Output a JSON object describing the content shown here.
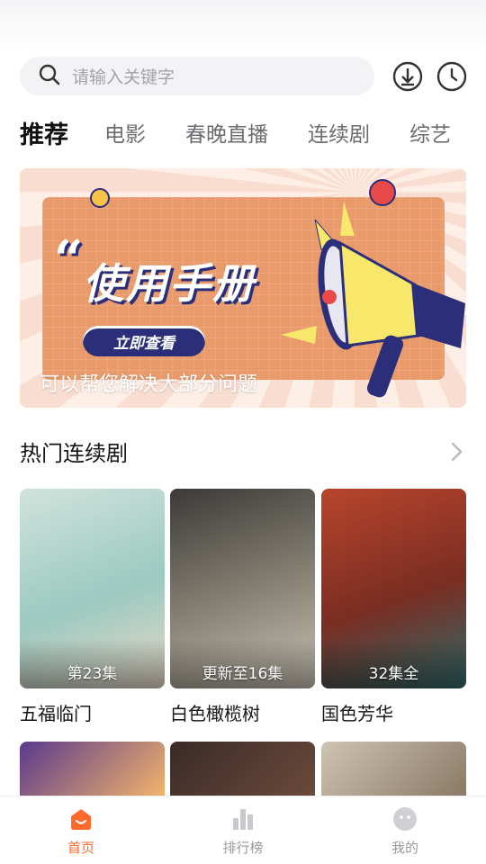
{
  "search": {
    "placeholder": "请输入关键字"
  },
  "header_icons": [
    "download-icon",
    "history-clock-icon"
  ],
  "tabs": [
    {
      "label": "推荐",
      "active": true
    },
    {
      "label": "电影",
      "active": false
    },
    {
      "label": "春晚直播",
      "active": false
    },
    {
      "label": "连续剧",
      "active": false
    },
    {
      "label": "综艺",
      "active": false
    }
  ],
  "banner": {
    "title": "使用手册",
    "quote_mark": "“",
    "button_label": "立即查看",
    "subtitle": "可以帮您解决大部分问题"
  },
  "section": {
    "title": "热门连续剧",
    "arrow_icon": "chevron-right-icon"
  },
  "cards": [
    {
      "title": "五福临门",
      "badge": "第23集",
      "colors": [
        "#cfe3dc",
        "#9cc9c0",
        "#e7d9c9"
      ]
    },
    {
      "title": "白色橄榄树",
      "badge": "更新至16集",
      "colors": [
        "#3b3a38",
        "#8a8476",
        "#c9c3b6"
      ]
    },
    {
      "title": "国色芳华",
      "badge": "32集全",
      "colors": [
        "#b8452c",
        "#7a2d22",
        "#2f6b6a"
      ]
    }
  ],
  "row2_colors": [
    [
      "#5a3a8c",
      "#f2b36b"
    ],
    [
      "#3a2a28",
      "#6b4a3a"
    ],
    [
      "#cfc3b3",
      "#8a7a66"
    ]
  ],
  "bottom_nav": [
    {
      "label": "首页",
      "icon": "home-smile-icon",
      "active": true
    },
    {
      "label": "排行榜",
      "icon": "ranking-bars-icon",
      "active": false
    },
    {
      "label": "我的",
      "icon": "profile-face-icon",
      "active": false
    }
  ],
  "colors": {
    "accent": "#ff6a2c",
    "banner_navy": "#2b2f7a",
    "banner_orange": "#e89a6b"
  }
}
